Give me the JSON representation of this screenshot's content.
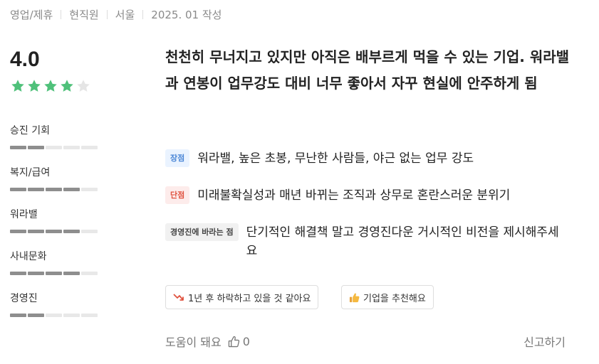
{
  "meta": {
    "job": "영업/제휴",
    "status": "현직원",
    "location": "서울",
    "date": "2025. 01 작성"
  },
  "rating": {
    "score": "4.0",
    "stars_filled": 4,
    "stars_total": 5,
    "star_color": "#4fc17a",
    "star_empty_color": "#e5e5e5"
  },
  "categories": [
    {
      "label": "승진 기회",
      "level": 2,
      "max": 5
    },
    {
      "label": "복지/급여",
      "level": 4,
      "max": 5
    },
    {
      "label": "워라밸",
      "level": 4,
      "max": 5
    },
    {
      "label": "사내문화",
      "level": 4,
      "max": 5
    },
    {
      "label": "경영진",
      "level": 2,
      "max": 5
    }
  ],
  "review": {
    "headline": "천천히 무너지고 있지만 아직은 배부르게 먹을 수 있는 기업. 워라밸과 연봉이 업무강도 대비 너무 좋아서 자꾸 현실에 안주하게 됨",
    "pros_tag": "장점",
    "pros": "워라밸, 높은 초봉, 무난한 사람들, 야근 없는 업무 강도",
    "cons_tag": "단점",
    "cons": "미래불확실성과 매년 바뀌는 조직과 상무로 혼란스러운 분위기",
    "message_tag": "경영진에 바라는 점",
    "message": "단기적인 해결책 말고 경영진다운 거시적인 비전을 제시해주세요"
  },
  "outlook": {
    "forecast": "1년 후 하락하고 있을 것 같아요",
    "recommend": "기업을 추천해요"
  },
  "footer": {
    "helpful": "도움이 돼요",
    "helpful_count": "0",
    "report": "신고하기"
  }
}
